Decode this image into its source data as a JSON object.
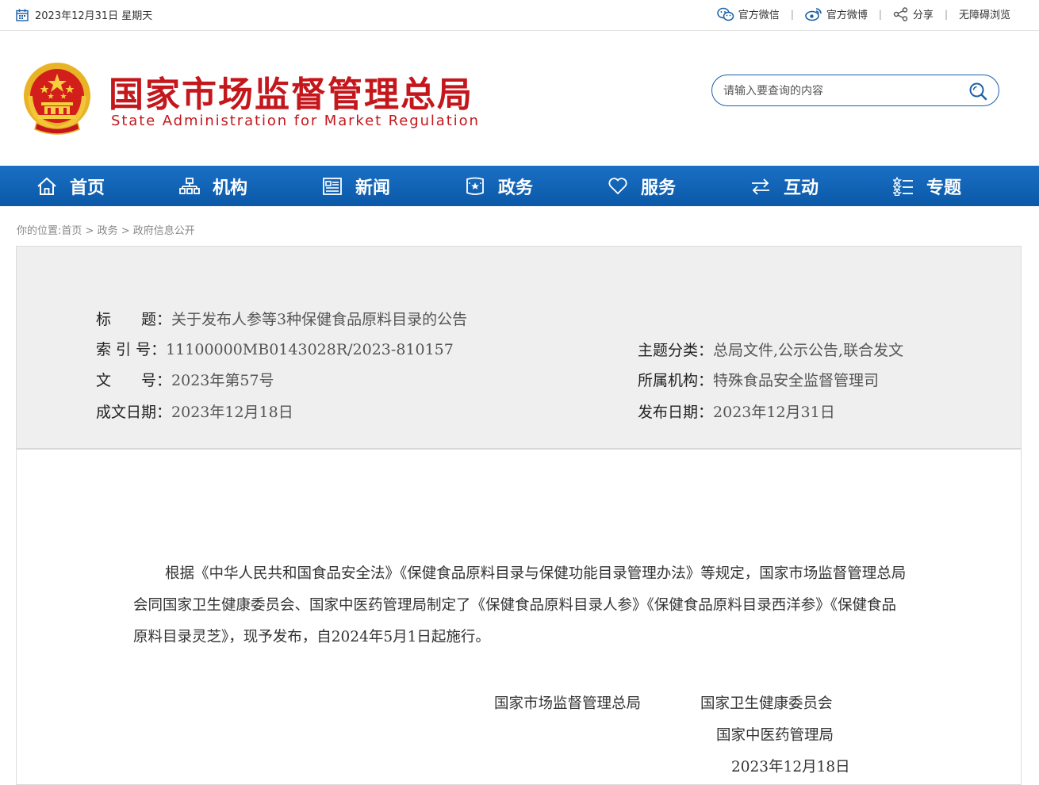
{
  "topbar": {
    "date": "2023年12月31日 星期天",
    "links": [
      {
        "label": "官方微信",
        "icon": "wechat-icon"
      },
      {
        "label": "官方微博",
        "icon": "weibo-icon"
      },
      {
        "label": "分享",
        "icon": "share-icon"
      },
      {
        "label": "无障碍浏览",
        "icon": ""
      }
    ],
    "separator": "|"
  },
  "header": {
    "title_cn": "国家市场监督管理总局",
    "title_en": "State Administration for Market Regulation",
    "brand_color": "#c4171c"
  },
  "search": {
    "placeholder": "请输入要查询的内容",
    "value": ""
  },
  "nav": {
    "color": "#0b59a8",
    "items": [
      {
        "label": "首页",
        "icon": "home-icon"
      },
      {
        "label": "机构",
        "icon": "org-chart-icon"
      },
      {
        "label": "新闻",
        "icon": "news-icon"
      },
      {
        "label": "政务",
        "icon": "government-affairs-icon"
      },
      {
        "label": "服务",
        "icon": "heart-icon"
      },
      {
        "label": "互动",
        "icon": "exchange-arrows-icon"
      },
      {
        "label": "专题",
        "icon": "topic-list-icon"
      }
    ]
  },
  "breadcrumb": {
    "prefix": "你的位置:",
    "items": [
      "首页",
      "政务",
      "政府信息公开"
    ],
    "separator": ">"
  },
  "meta": {
    "title_label": "标　　题：",
    "title": "关于发布人参等3种保健食品原料目录的公告",
    "index_label": "索 引 号：",
    "index": "11100000MB0143028R/2023-810157",
    "docno_label": "文　　号：",
    "docno": "2023年第57号",
    "date_label": "成文日期：",
    "date": "2023年12月18日",
    "topic_label": "主题分类：",
    "topic": "总局文件,公示公告,联合发文",
    "org_label": "所属机构：",
    "org": "特殊食品安全监督管理司",
    "pubdate_label": "发布日期：",
    "pubdate": "2023年12月31日"
  },
  "article": {
    "paragraph": "根据《中华人民共和国食品安全法》《保健食品原料目录与保健功能目录管理办法》等规定，国家市场监督管理总局会同国家卫生健康委员会、国家中医药管理局制定了《保健食品原料目录人参》《保健食品原料目录西洋参》《保健食品原料目录灵芝》，现予发布，自2024年5月1日起施行。",
    "signers": [
      "国家市场监督管理总局",
      "国家卫生健康委员会",
      "国家中医药管理局"
    ],
    "sign_date": "2023年12月18日"
  }
}
